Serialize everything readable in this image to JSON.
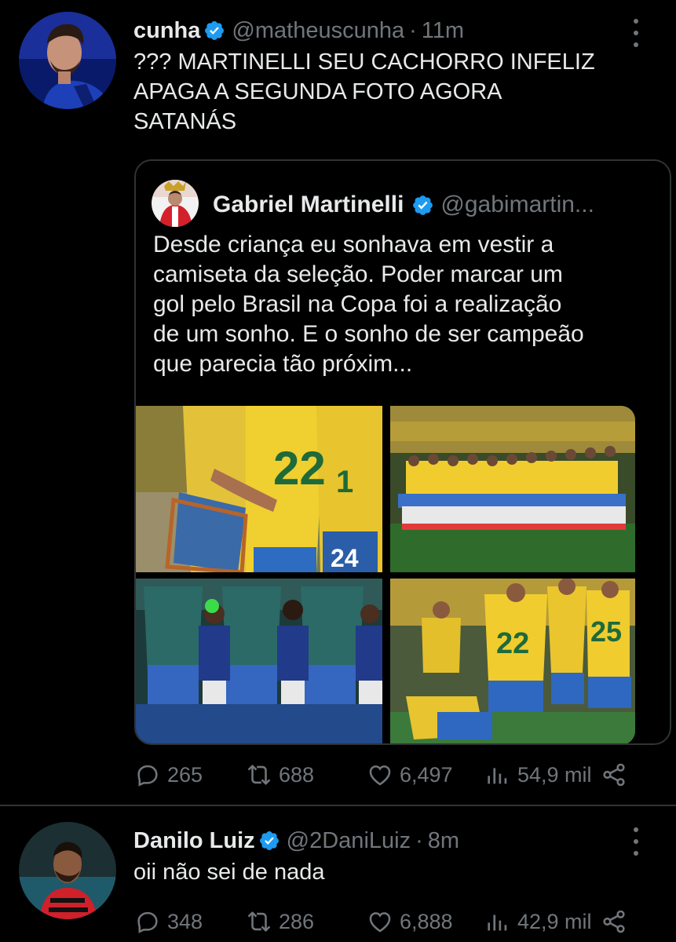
{
  "tweet1": {
    "name": "cunha",
    "handle": "@matheuscunha",
    "time": "11m",
    "text": "??? MARTINELLI SEU CACHORRO INFELIZ\nAPAGA A SEGUNDA FOTO AGORA\nSATANÁS",
    "quote": {
      "name": "Gabriel Martinelli",
      "handle": "@gabimartin...",
      "text": "Desde criança eu sonhava em vestir a\ncamiseta da seleção. Poder marcar um\ngol pelo Brasil na Copa foi a realização\nde um sonho. E o sonho de ser campeão\nque parecia tão próxim...",
      "media": [
        "photo-celebration",
        "photo-team-lineup",
        "photo-players-with-kids",
        "photo-players-consoling"
      ]
    },
    "stats": {
      "replies": "265",
      "retweets": "688",
      "likes": "6,497",
      "views": "54,9 mil"
    }
  },
  "tweet2": {
    "name": "Danilo Luiz",
    "handle": "@2DaniLuiz",
    "time": "8m",
    "text": "oii não sei de nada",
    "stats": {
      "replies": "348",
      "retweets": "286",
      "likes": "6,888",
      "views": "42,9 mil"
    }
  },
  "colors": {
    "background": "#000000",
    "text": "#e7e9ea",
    "muted": "#71767b",
    "verified": "#1d9bf0",
    "border": "#2f3336"
  },
  "icons": [
    "reply-icon",
    "retweet-icon",
    "like-icon",
    "views-icon",
    "share-icon",
    "more-icon",
    "verified-icon"
  ]
}
